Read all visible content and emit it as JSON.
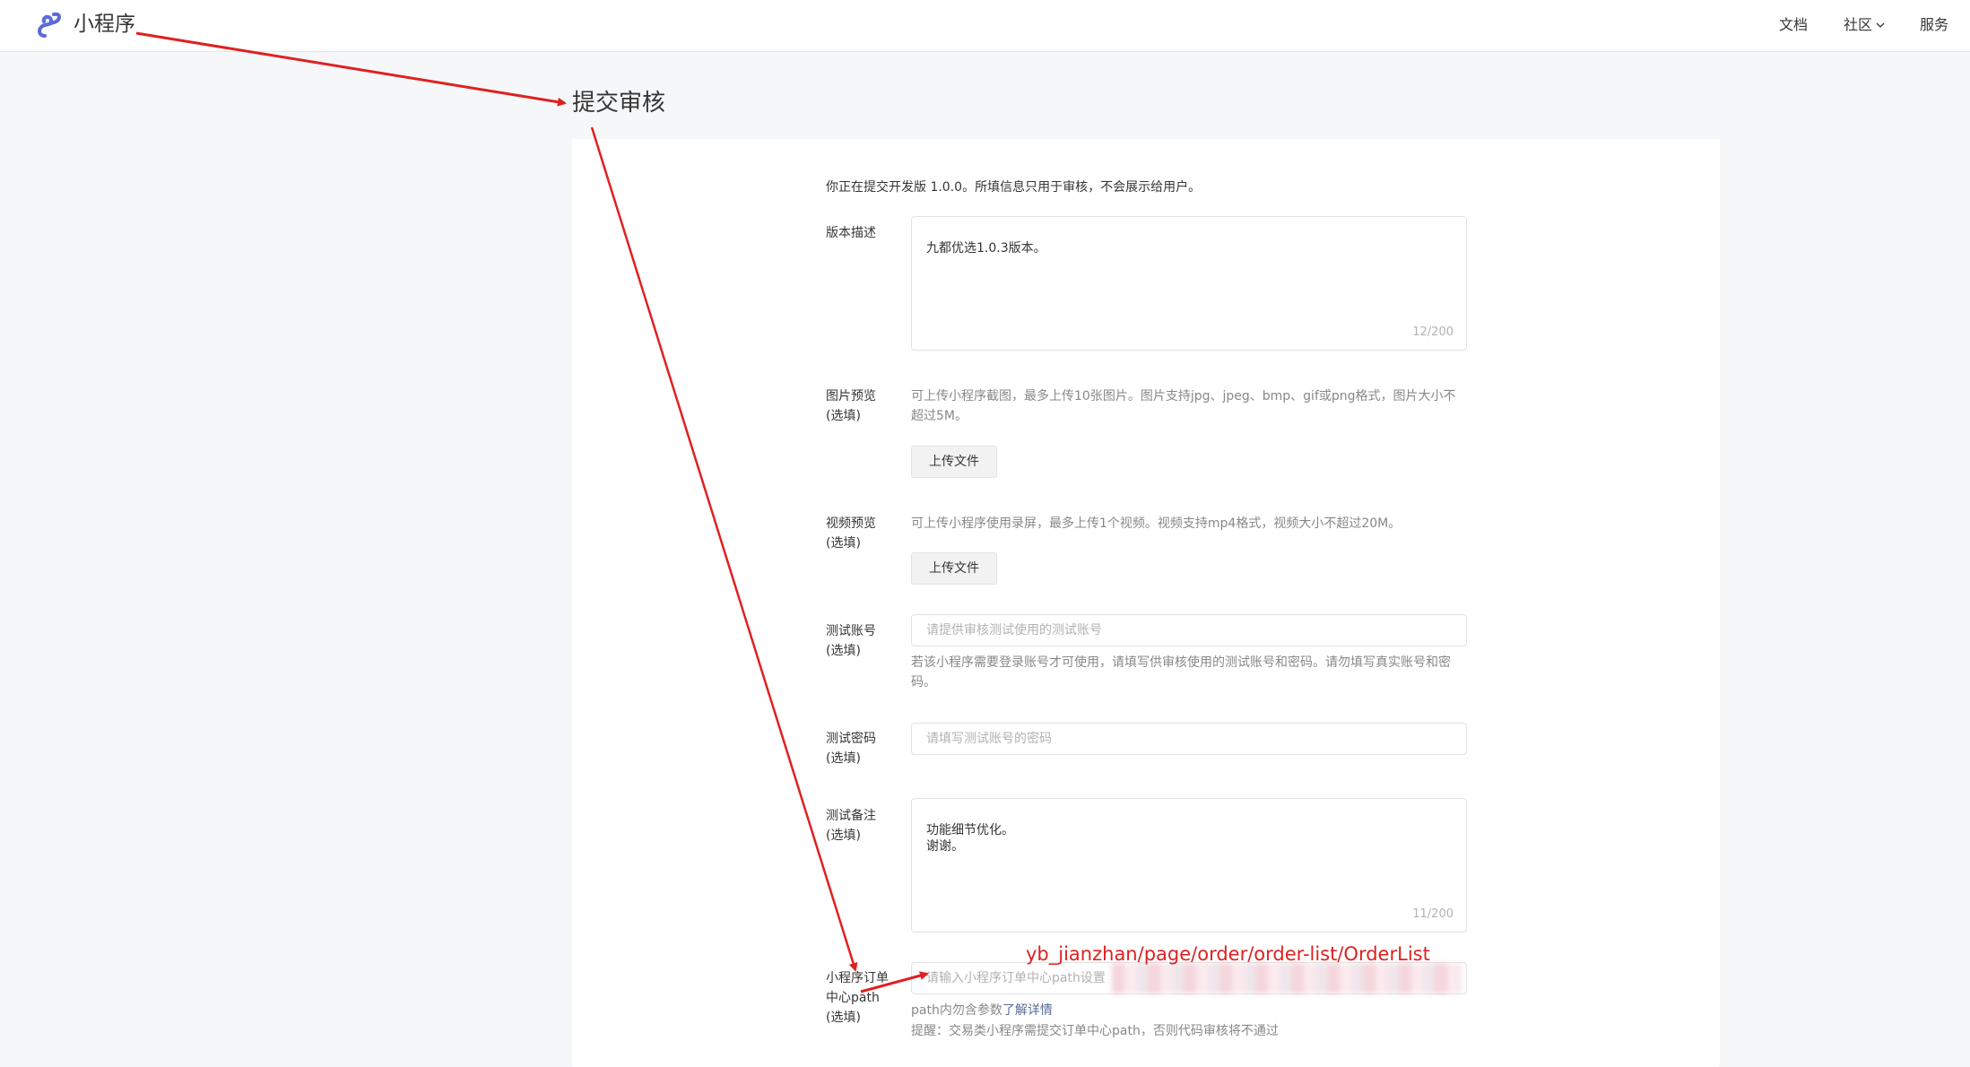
{
  "header": {
    "app_title": "小程序",
    "nav": {
      "docs": "文档",
      "community": "社区",
      "services": "服务"
    }
  },
  "page": {
    "title": "提交审核",
    "notice": "你正在提交开发版 1.0.0。所填信息只用于审核，不会展示给用户。"
  },
  "form": {
    "version_desc": {
      "label": "版本描述",
      "value": "九都优选1.0.3版本。",
      "counter": "12/200"
    },
    "image_preview": {
      "label": "图片预览\n(选填)",
      "desc": "可上传小程序截图，最多上传10张图片。图片支持jpg、jpeg、bmp、gif或png格式，图片大小不超过5M。",
      "button": "上传文件"
    },
    "video_preview": {
      "label": "视频预览\n(选填)",
      "desc": "可上传小程序使用录屏，最多上传1个视频。视频支持mp4格式，视频大小不超过20M。",
      "button": "上传文件"
    },
    "test_account": {
      "label": "测试账号\n(选填)",
      "placeholder": "请提供审核测试使用的测试账号",
      "desc": "若该小程序需要登录账号才可使用，请填写供审核使用的测试账号和密码。请勿填写真实账号和密码。"
    },
    "test_password": {
      "label": "测试密码\n(选填)",
      "placeholder": "请填写测试账号的密码"
    },
    "test_notes": {
      "label": "测试备注\n(选填)",
      "value": "功能细节优化。\n谢谢。",
      "counter": "11/200"
    },
    "order_path": {
      "label": "小程序订单\n中心path\n(选填)",
      "placeholder": "请输入小程序订单中心path设置",
      "hint_prefix": "path内勿含参数",
      "hint_link": "了解详情",
      "reminder": "提醒：交易类小程序需提交订单中心path，否则代码审核将不通过"
    }
  },
  "annotation": {
    "path_text": "yb_jianzhan/page/order/order-list/OrderList",
    "color": "#e02020"
  }
}
